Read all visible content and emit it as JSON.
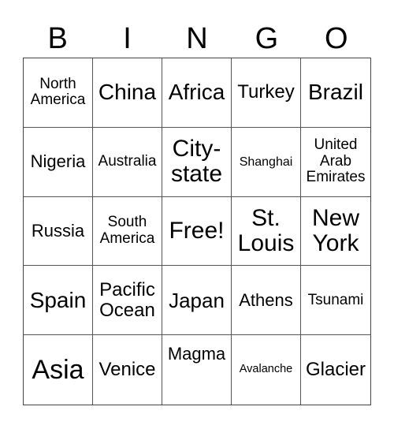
{
  "header": {
    "letters": [
      "B",
      "I",
      "N",
      "G",
      "O"
    ]
  },
  "cells": [
    "North America",
    "China",
    "Africa",
    "Turkey",
    "Brazil",
    "Nigeria",
    "Australia",
    "City-state",
    "Shanghai",
    "United Arab Emirates",
    "Russia",
    "South America",
    "Free!",
    "St. Louis",
    "New York",
    "Spain",
    "Pacific Ocean",
    "Japan",
    "Athens",
    "Tsunami",
    "Asia",
    "Venice",
    "Magma",
    "Avalanche",
    "Glacier"
  ],
  "display": [
    "North\nAmerica",
    "China",
    "Africa",
    "Turkey",
    "Brazil",
    "Nigeria",
    "Australia",
    "City-\nstate",
    "Shanghai",
    "United\nArab\nEmirates",
    "Russia",
    "South\nAmerica",
    "Free!",
    "St.\nLouis",
    "New\nYork",
    "Spain",
    "Pacific\nOcean",
    "Japan",
    "Athens",
    "Tsunami",
    "Asia",
    "Venice",
    "Magma",
    "Avalanche",
    "Glacier"
  ]
}
